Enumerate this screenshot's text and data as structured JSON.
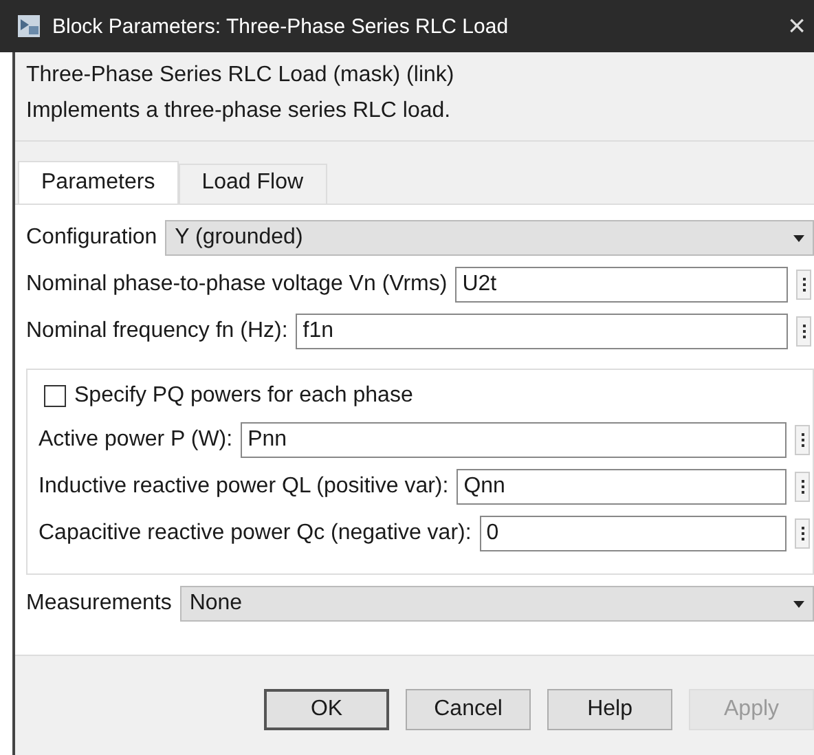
{
  "window": {
    "title": "Block Parameters: Three-Phase Series RLC Load",
    "close": "×"
  },
  "header": {
    "title": "Three-Phase Series RLC Load (mask) (link)",
    "description": "Implements a three-phase series RLC load."
  },
  "tabs": [
    {
      "label": "Parameters",
      "selected": true
    },
    {
      "label": "Load Flow",
      "selected": false
    }
  ],
  "rows": [
    {
      "kind": "dropdown",
      "label": "Configuration",
      "value": "Y (grounded)"
    },
    {
      "kind": "field",
      "label": "Nominal phase-to-phase voltage Vn (Vrms)",
      "value": "U2t"
    },
    {
      "kind": "field",
      "label": "Nominal frequency fn (Hz):",
      "value": "f1n"
    },
    {
      "kind": "group",
      "checkbox": {
        "label": "Specify PQ powers for each phase",
        "checked": false
      },
      "children": [
        {
          "kind": "field",
          "label": "Active power P (W):",
          "value": "Pnn"
        },
        {
          "kind": "field",
          "label": "Inductive reactive power QL (positive var):",
          "value": "Qnn"
        },
        {
          "kind": "field",
          "label": "Capacitive reactive power Qc (negative var):",
          "value": "0"
        }
      ]
    },
    {
      "kind": "dropdown",
      "label": "Measurements",
      "value": "None"
    }
  ],
  "buttons": [
    {
      "label": "OK",
      "disabled": false,
      "default": true
    },
    {
      "label": "Cancel",
      "disabled": false,
      "default": false
    },
    {
      "label": "Help",
      "disabled": false,
      "default": false
    },
    {
      "label": "Apply",
      "disabled": true,
      "default": false
    }
  ]
}
